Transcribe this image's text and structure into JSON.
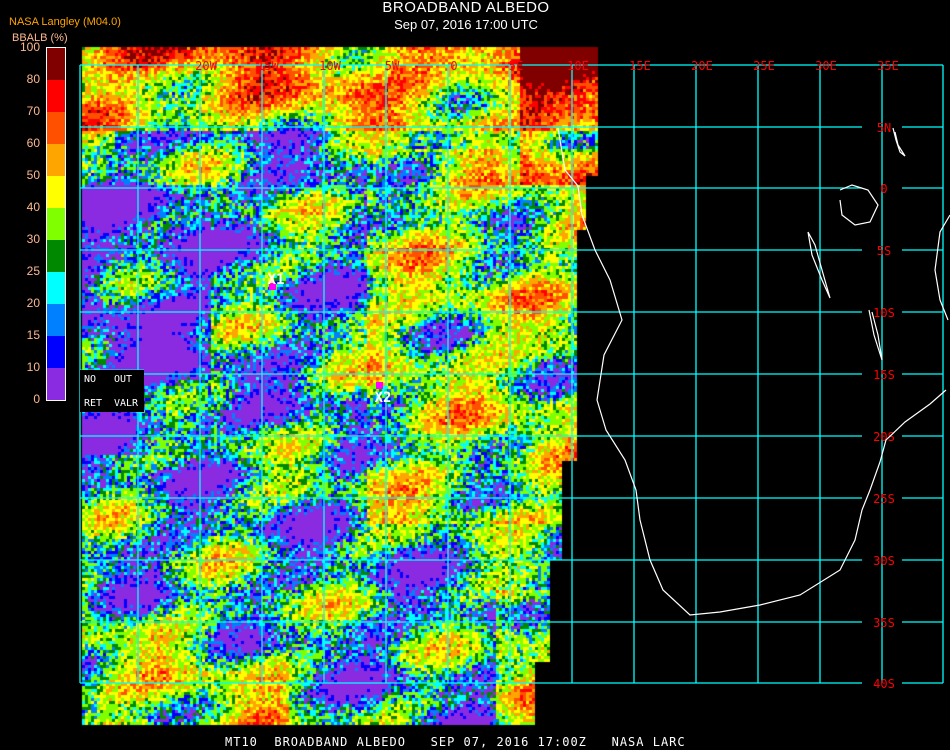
{
  "header": {
    "title": "BROADBAND ALBEDO",
    "subtitle": "Sep 07, 2016 17:00 UTC",
    "organization": "NASA Langley (M04.0)",
    "unit_label": "BBALB (%)"
  },
  "colorbar": {
    "ticks": [
      "0",
      "10",
      "15",
      "20",
      "25",
      "30",
      "40",
      "50",
      "60",
      "70",
      "80",
      "100"
    ],
    "colors": [
      "#8a2be2",
      "#0000ff",
      "#0080ff",
      "#00ffff",
      "#008800",
      "#80ff00",
      "#ffff00",
      "#ffa500",
      "#ff5000",
      "#ff0000",
      "#800000"
    ]
  },
  "no_value_box": {
    "no": "NO",
    "out": "OUT",
    "ret": "RET",
    "valr": "VALR"
  },
  "grid": {
    "lon_labels": [
      "20W",
      "15W",
      "10W",
      "5W",
      "0",
      "5E",
      "10E",
      "15E",
      "20E",
      "25E",
      "30E",
      "35E"
    ],
    "lat_labels": [
      "5N",
      "0",
      "5S",
      "10S",
      "15S",
      "20S",
      "25S",
      "30S",
      "35S",
      "40S"
    ],
    "grid_color": "#00ffff",
    "label_color": "#ff0000",
    "coast_color": "#ffffff"
  },
  "markers": [
    {
      "label": "X1",
      "color": "#ff00ff"
    },
    {
      "label": "X2",
      "color": "#ff00ff"
    }
  ],
  "footer": {
    "product": "MT10",
    "name": "BROADBAND ALBEDO",
    "datetime": "SEP 07, 2016 17:00Z",
    "source": "NASA LARC"
  }
}
